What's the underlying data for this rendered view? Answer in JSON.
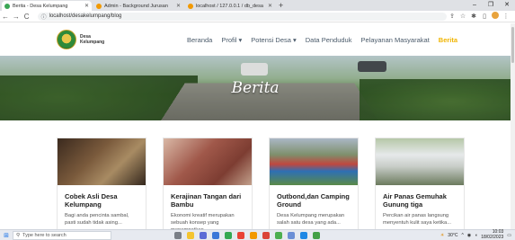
{
  "browser": {
    "tabs": [
      {
        "label": "Berita - Desa Kelumpang",
        "active": true,
        "icon_color": "#3aa655"
      },
      {
        "label": "Admin - Background Jurusan",
        "active": false,
        "icon_color": "#f29900"
      },
      {
        "label": "localhost / 127.0.0.1 / db_desa",
        "active": false,
        "icon_color": "#f29900"
      }
    ],
    "new_tab": "+",
    "window_controls": {
      "minimize": "–",
      "maximize": "❐",
      "close": "✕"
    },
    "url": "localhost/desakelumpang/blog",
    "nav": {
      "back": "←",
      "forward": "→",
      "reload": "C"
    }
  },
  "site": {
    "logo_text": "Desa Kelumpang",
    "menu": [
      {
        "label": "Beranda",
        "active": false
      },
      {
        "label": "Profil ▾",
        "active": false
      },
      {
        "label": "Potensi Desa ▾",
        "active": false
      },
      {
        "label": "Data Penduduk",
        "active": false
      },
      {
        "label": "Pelayanan Masyarakat",
        "active": false
      },
      {
        "label": "Berita",
        "active": true
      }
    ],
    "hero_title": "Berita",
    "accent_color": "#f0b400"
  },
  "cards": [
    {
      "title": "Cobek Asli Desa Kelumpang",
      "desc": "Bagi anda pencinta sambal, pasti sudah tidak asing..."
    },
    {
      "title": "Kerajinan Tangan dari Bambu",
      "desc": "Ekonomi kreatif merupakan sebuah konsep yang menempatkan..."
    },
    {
      "title": "Outbond,dan Camping Ground",
      "desc": "Desa Kelumpang merupakan salah satu desa yang ada..."
    },
    {
      "title": "Air Panas Gemuhak Gunung tiga",
      "desc": "Percikan air panas langsung menyentuh kulit saya ketika..."
    }
  ],
  "taskbar": {
    "search_placeholder": "Type here to search",
    "weather": "30°C",
    "time": "10:03",
    "date": "18/02/2023"
  }
}
